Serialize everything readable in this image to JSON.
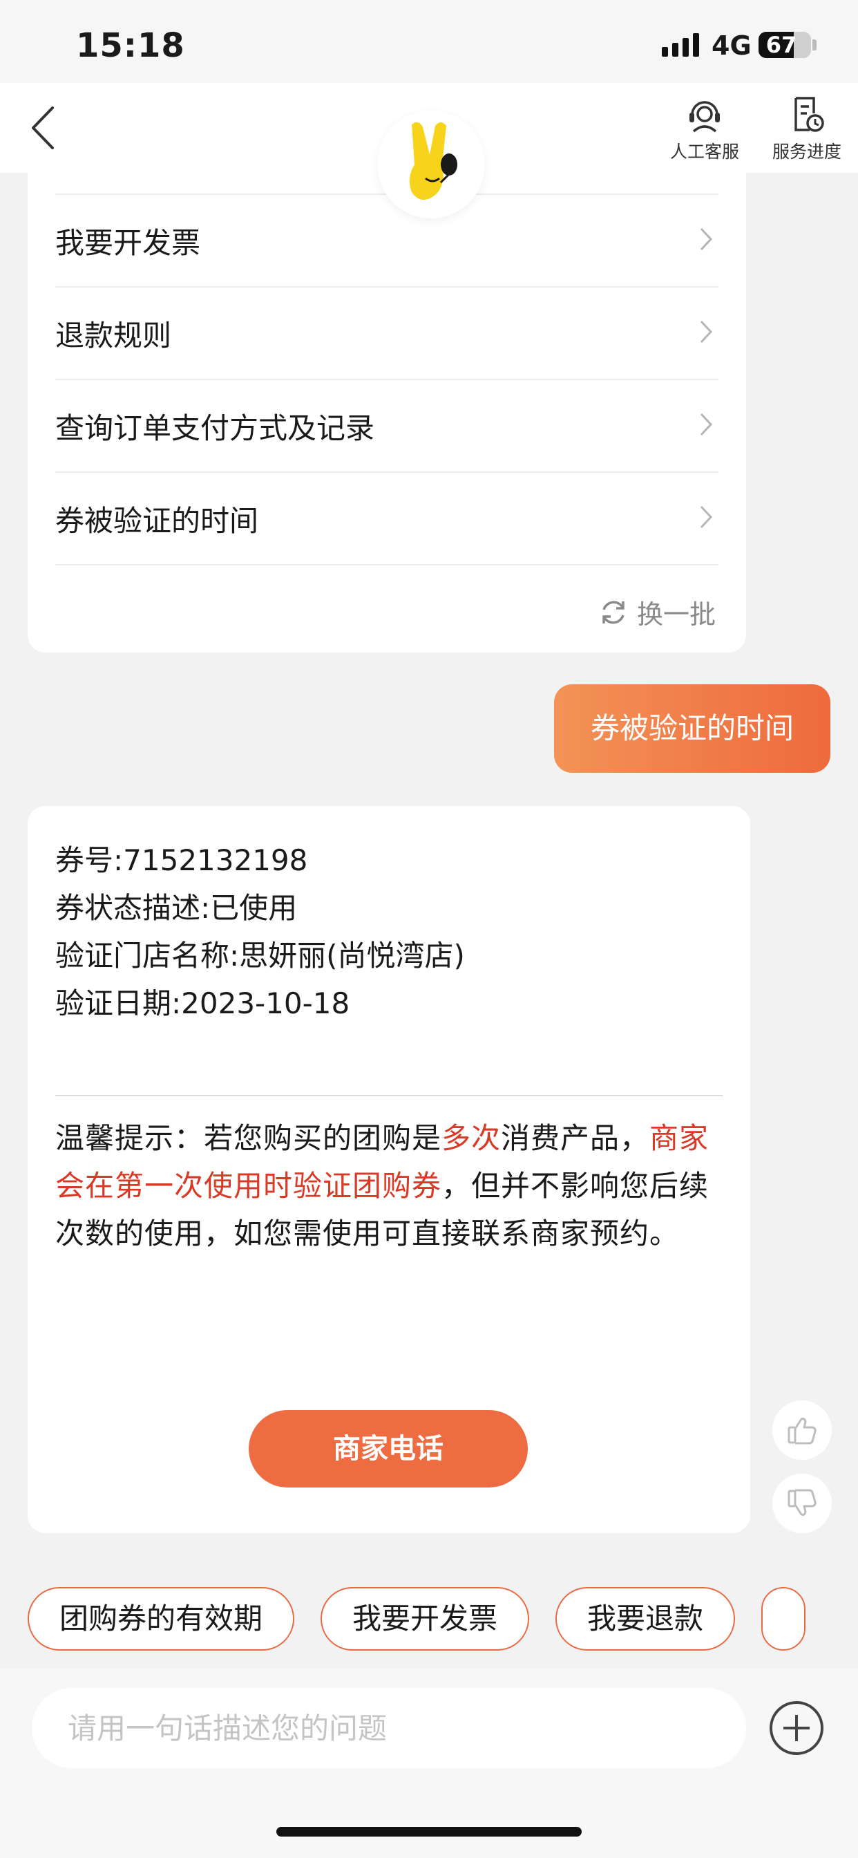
{
  "status_bar": {
    "time": "15:18",
    "network": "4G",
    "battery": "67",
    "battery_level": 0.67
  },
  "nav": {
    "actions": [
      {
        "label": "人工客服",
        "icon": "headset-icon"
      },
      {
        "label": "服务进度",
        "icon": "progress-document-icon"
      }
    ]
  },
  "faq": {
    "items": [
      {
        "label": "我要开发票"
      },
      {
        "label": "退款规则"
      },
      {
        "label": "查询订单支付方式及记录"
      },
      {
        "label": "券被验证的时间"
      }
    ],
    "refresh_label": "换一批"
  },
  "user_message": "券被验证的时间",
  "answer": {
    "lines": [
      "券号:7152132198",
      "券状态描述:已使用",
      "验证门店名称:思妍丽(尚悦湾店)",
      "验证日期:2023-10-18"
    ],
    "tip_parts": [
      {
        "text": "温馨提示：若您购买的团购是",
        "highlight": false
      },
      {
        "text": "多次",
        "highlight": true
      },
      {
        "text": "消费产品，",
        "highlight": false
      },
      {
        "text": "商家会在第一次使用时验证团购券",
        "highlight": true
      },
      {
        "text": "，但并不影响您后续次数的使用，如您需使用可直接联系商家预约。",
        "highlight": false
      }
    ],
    "call_button": "商家电话"
  },
  "quick_replies": [
    "团购券的有效期",
    "我要开发票",
    "我要退款",
    ""
  ],
  "input": {
    "placeholder": "请用一句话描述您的问题"
  },
  "colors": {
    "accent": "#ee6c42",
    "highlight": "#d93a26",
    "background": "#f2f2f2"
  }
}
